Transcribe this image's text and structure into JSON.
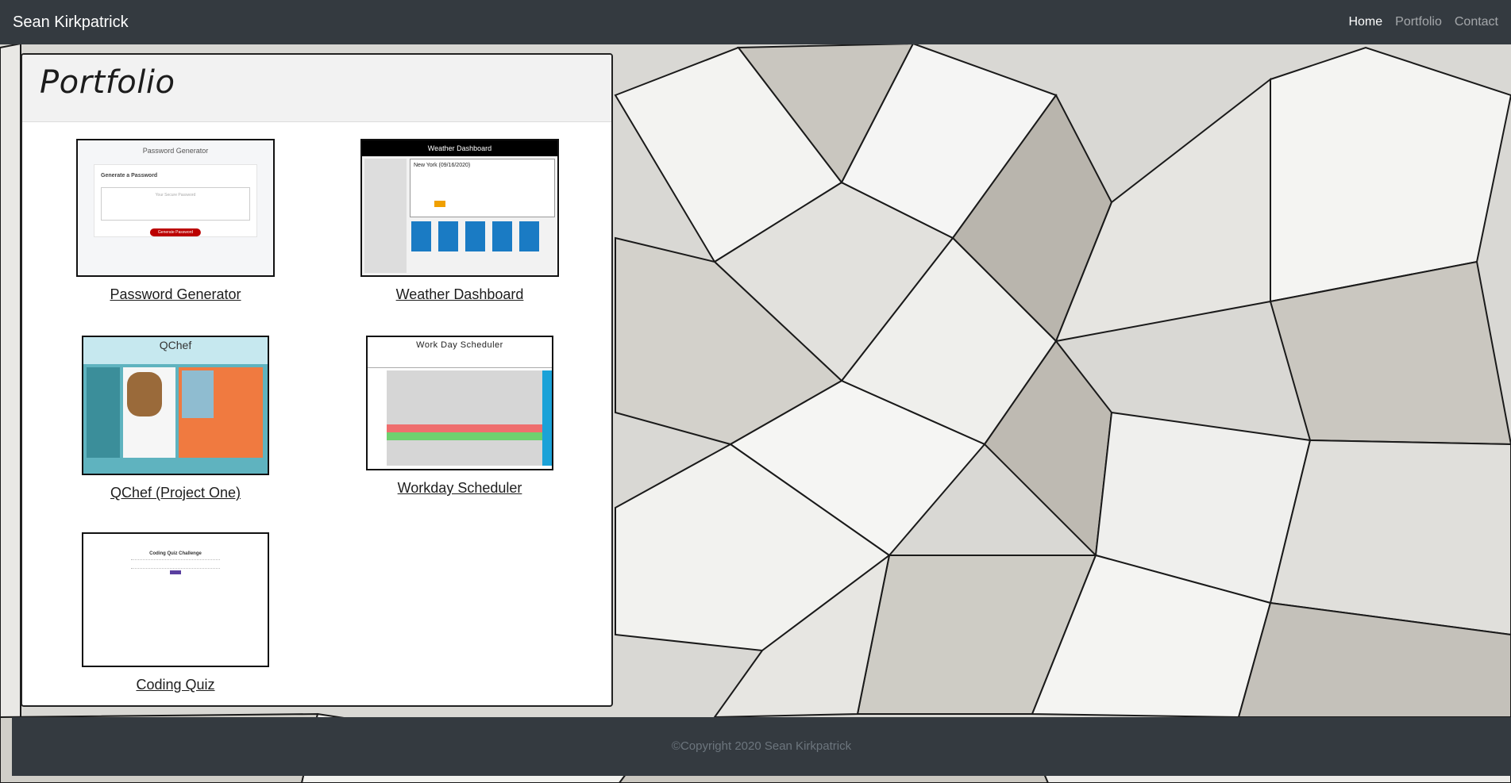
{
  "navbar": {
    "brand": "Sean Kirkpatrick",
    "links": [
      {
        "label": "Home",
        "active": true
      },
      {
        "label": "Portfolio",
        "active": false
      },
      {
        "label": "Contact",
        "active": false
      }
    ]
  },
  "portfolio": {
    "title": "Portfolio",
    "projects": [
      {
        "label": "Password Generator"
      },
      {
        "label": "Weather Dashboard"
      },
      {
        "label": "QChef (Project One)"
      },
      {
        "label": "Workday Scheduler"
      },
      {
        "label": "Coding Quiz"
      }
    ]
  },
  "footer": {
    "text": "©Copyright 2020 Sean Kirkpatrick"
  },
  "colors": {
    "navbar": "#343a40",
    "footer": "#343a40",
    "nav_active": "#ffffff",
    "nav_inactive": "#9a9da1"
  }
}
